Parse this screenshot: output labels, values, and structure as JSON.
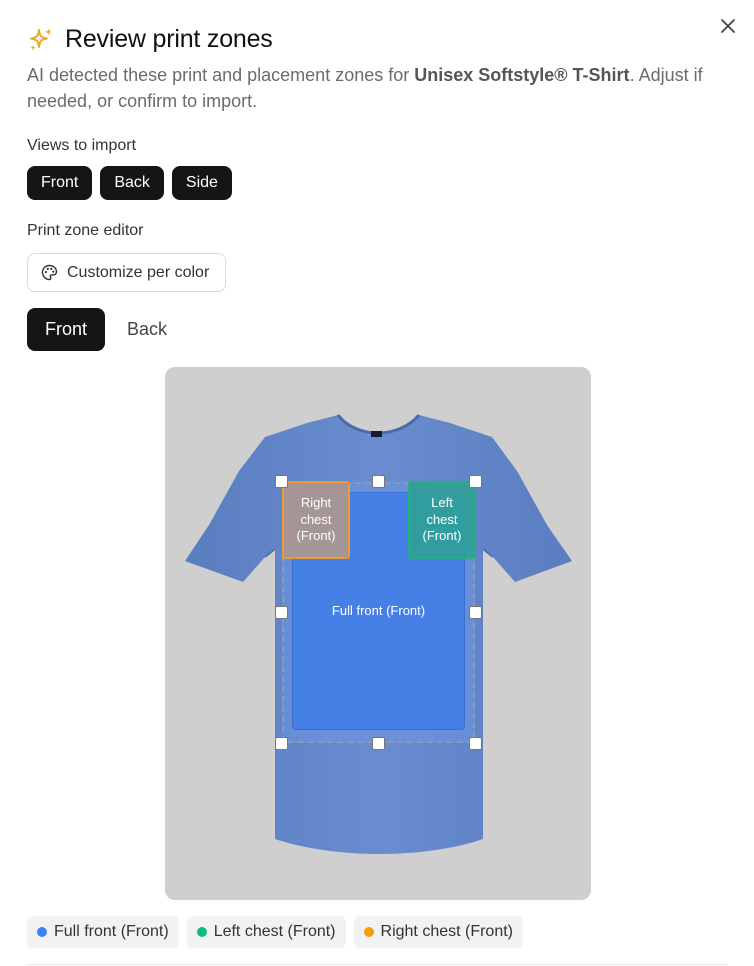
{
  "dialog": {
    "title": "Review print zones",
    "description_prefix": "AI detected these print and placement zones for ",
    "product_name": "Unisex Softstyle® T-Shirt",
    "description_suffix": ". Adjust if needed, or confirm to import.",
    "accent_color": "#f5a524"
  },
  "views_to_import": {
    "label": "Views to import",
    "views": [
      "Front",
      "Back",
      "Side"
    ]
  },
  "editor": {
    "label": "Print zone editor",
    "customize_label": "Customize per color",
    "tabs": [
      {
        "label": "Front",
        "active": true
      },
      {
        "label": "Back",
        "active": false
      }
    ]
  },
  "zones": {
    "full_front": {
      "label": "Full front (Front)",
      "color": "#3b82f6"
    },
    "left_chest": {
      "label": "Left\nchest\n(Front)",
      "color": "#10b981"
    },
    "right_chest": {
      "label": "Right\nchest\n(Front)",
      "color": "#f59e0b"
    }
  },
  "legend": [
    {
      "label": "Full front (Front)",
      "color": "#3b82f6"
    },
    {
      "label": "Left chest (Front)",
      "color": "#10b981"
    },
    {
      "label": "Right chest (Front)",
      "color": "#f59e0b"
    }
  ],
  "icons": {
    "title": "sparkles-icon",
    "close": "close-icon",
    "customize": "palette-icon"
  }
}
